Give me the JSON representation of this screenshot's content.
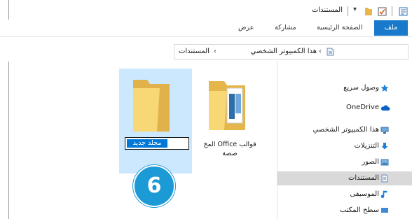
{
  "window": {
    "title": "المستندات"
  },
  "ribbon": {
    "tabs": [
      "ملف",
      "الصفحة الرئيسية",
      "مشاركة",
      "عرض"
    ],
    "active_tab_color": "#1979ca"
  },
  "address_bar": {
    "crumbs": [
      "هذا الكمبيوتر الشخصي",
      "المستندات"
    ]
  },
  "navigation_pane": {
    "items": [
      {
        "label": "وصول سريع",
        "icon": "star-icon"
      },
      {
        "label": "OneDrive",
        "icon": "cloud-icon"
      },
      {
        "label": "هذا الكمبيوتر الشخصي",
        "icon": "computer-icon"
      },
      {
        "label": "التنزيلات",
        "icon": "download-icon"
      },
      {
        "label": "الصور",
        "icon": "pictures-icon"
      },
      {
        "label": "المستندات",
        "icon": "documents-icon"
      },
      {
        "label": "الموسيقى",
        "icon": "music-icon"
      },
      {
        "label": "سطح المكتب",
        "icon": "desktop-icon"
      }
    ]
  },
  "files": [
    {
      "name_line1": "قوالب Office المخ",
      "name_line2": "صصة",
      "icon": "folder-icon"
    },
    {
      "name": "مجلد جديد",
      "icon": "folder-icon",
      "renaming": true
    }
  ],
  "step_badge": {
    "number": "6",
    "color": "#1c9ad6"
  }
}
